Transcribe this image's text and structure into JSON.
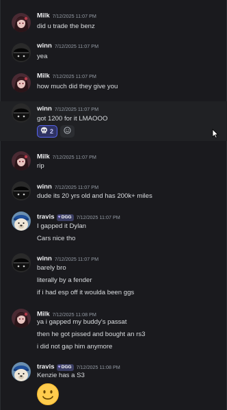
{
  "channel": {
    "messages": [
      {
        "author": "Milk",
        "timestamp": "7/12/2025 11:07 PM",
        "lines": [
          "did u trade the benz"
        ]
      },
      {
        "author": "winn",
        "timestamp": "7/12/2025 11:07 PM",
        "lines": [
          "yea"
        ]
      },
      {
        "author": "Milk",
        "timestamp": "7/12/2025 11:07 PM",
        "lines": [
          "how much did they give you"
        ]
      },
      {
        "author": "winn",
        "timestamp": "7/12/2025 11:07 PM",
        "lines": [
          "got 1200 for it LMAOOO"
        ],
        "reactions": [
          {
            "emoji": "skull-emoji",
            "count": "2"
          }
        ],
        "add_reaction_icon": "add-reaction-icon"
      },
      {
        "author": "Milk",
        "timestamp": "7/12/2025 11:07 PM",
        "lines": [
          "rip"
        ]
      },
      {
        "author": "winn",
        "timestamp": "7/12/2025 11:07 PM",
        "lines": [
          "dude its 20 yrs old and has 200k+ miles"
        ]
      },
      {
        "author": "travis",
        "tag": "DGG",
        "timestamp": "7/12/2025 11:07 PM",
        "lines": [
          "I gapped it Dylan",
          "Cars nice tho"
        ]
      },
      {
        "author": "winn",
        "timestamp": "7/12/2025 11:07 PM",
        "lines": [
          "barely bro",
          "literally by a fender",
          "if i had esp off it woulda been ggs"
        ]
      },
      {
        "author": "Milk",
        "timestamp": "7/12/2025 11:08 PM",
        "lines": [
          "ya i gapped my buddy's passat",
          "then he got pissed and bought an rs3",
          "i did not gap him anymore"
        ]
      },
      {
        "author": "travis",
        "tag": "DGG",
        "timestamp": "7/12/2025 11:08 PM",
        "lines": [
          "Kenzie has a S3"
        ],
        "emoji_only": "slightly-smiling-face-emoji"
      }
    ]
  },
  "colors": {
    "background": "#1a1a1e",
    "hover_background": "#202124",
    "username": "#f2f3f5",
    "message_text": "#dbdee1",
    "timestamp": "#949ba4",
    "reaction_active_border": "#5865f2",
    "tag_background": "#3b3e63"
  }
}
